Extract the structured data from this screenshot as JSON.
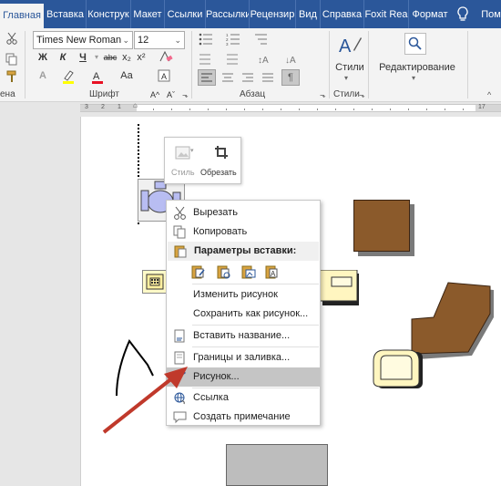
{
  "tabs": [
    {
      "label": "Главная",
      "active": true
    },
    {
      "label": "Вставка"
    },
    {
      "label": "Конструк"
    },
    {
      "label": "Макет"
    },
    {
      "label": "Ссылки"
    },
    {
      "label": "Рассылки"
    },
    {
      "label": "Рецензир"
    },
    {
      "label": "Вид"
    },
    {
      "label": "Справка"
    },
    {
      "label": "Foxit Rea"
    },
    {
      "label": "Формат"
    },
    {
      "label": "Пом"
    }
  ],
  "ribbon": {
    "font_name": "Times New Roman",
    "font_size": "12",
    "group_font_label": "Шрифт",
    "group_paragraph_label": "Абзац",
    "group_styles_label": "Стили",
    "clipboard_partial_label": "ена",
    "styles_label": "Стили",
    "editing_label": "Редактирование",
    "btn_bold": "Ж",
    "btn_italic": "К",
    "btn_underline": "Ч",
    "btn_strike": "abc",
    "btn_sub": "x₂",
    "btn_sup": "x²",
    "btn_font_color": "A",
    "btn_grow": "A^",
    "btn_shrink": "Aˇ",
    "btn_case": "Aa",
    "btn_clear_fmt": "A"
  },
  "ruler": {
    "left_marks": [
      "3",
      "2",
      "1"
    ],
    "right_mark": "17"
  },
  "minitoolbar": {
    "style_label": "Стиль",
    "crop_label": "Обрезать"
  },
  "context_menu": {
    "items": [
      {
        "label": "Вырезать",
        "icon": "scissors-icon"
      },
      {
        "label": "Копировать",
        "icon": "copy-icon"
      },
      {
        "label": "Параметры вставки:",
        "icon": "paste-icon",
        "header": true
      },
      {
        "label": "Изменить рисунок",
        "icon": ""
      },
      {
        "label": "Сохранить как рисунок...",
        "icon": ""
      },
      {
        "label": "Вставить название...",
        "icon": "caption-icon"
      },
      {
        "label": "Границы и заливка...",
        "icon": "page-icon"
      },
      {
        "label": "Рисунок...",
        "icon": "picture-format-icon",
        "highlighted": true
      },
      {
        "label": "Ссылка",
        "icon": "link-icon"
      },
      {
        "label": "Создать примечание",
        "icon": "comment-icon"
      }
    ]
  },
  "colors": {
    "tab_bar": "#2b579a",
    "ribbon": "#f3f3f3",
    "highlight": "#c5c5c5",
    "brown_shape": "#8b5a2b",
    "gray_shape": "#bdbdbd",
    "arrow": "#c0392b"
  }
}
